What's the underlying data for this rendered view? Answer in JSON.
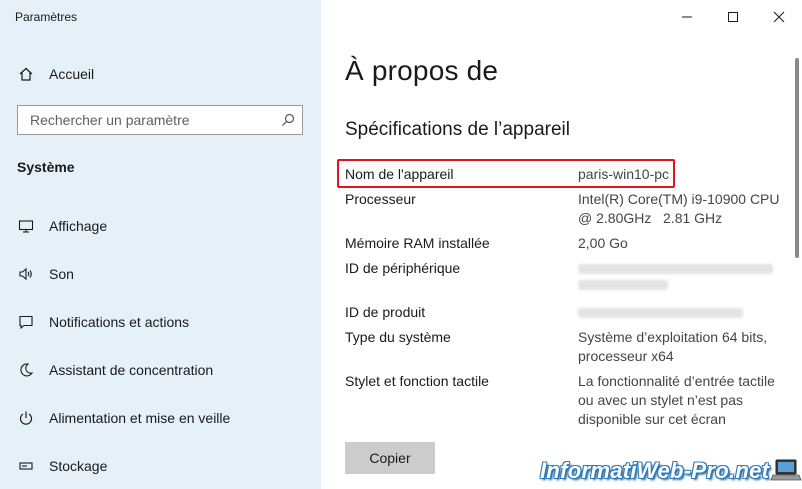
{
  "window": {
    "title": "Paramètres"
  },
  "sidebar": {
    "home_label": "Accueil",
    "search_placeholder": "Rechercher un paramètre",
    "section_title": "Système",
    "items": [
      {
        "label": "Affichage",
        "icon": "monitor-icon"
      },
      {
        "label": "Son",
        "icon": "speaker-icon"
      },
      {
        "label": "Notifications et actions",
        "icon": "notification-icon"
      },
      {
        "label": "Assistant de concentration",
        "icon": "moon-icon"
      },
      {
        "label": "Alimentation et mise en veille",
        "icon": "power-icon"
      },
      {
        "label": "Stockage",
        "icon": "storage-icon"
      }
    ]
  },
  "main": {
    "title": "À propos de",
    "section_title": "Spécifications de l’appareil",
    "specs": [
      {
        "label": "Nom de l'appareil",
        "value": "paris-win10-pc"
      },
      {
        "label": "Processeur",
        "value_line1": "Intel(R) Core(TM) i9-10900 CPU",
        "value_line2": "@ 2.80GHz   2.81 GHz"
      },
      {
        "label": "Mémoire RAM installée",
        "value": "2,00 Go"
      },
      {
        "label": "ID de périphérique",
        "value": ""
      },
      {
        "label": "ID de produit",
        "value": ""
      },
      {
        "label": "Type du système",
        "value_line1": "Système d’exploitation 64 bits,",
        "value_line2": "processeur x64"
      },
      {
        "label": "Stylet et fonction tactile",
        "value_line1": "La fonctionnalité d’entrée tactile",
        "value_line2": "ou avec un stylet n’est pas",
        "value_line3": "disponible sur cet écran"
      }
    ],
    "copy_button": "Copier"
  },
  "watermark": {
    "text": "InformatiWeb-Pro.net"
  },
  "colors": {
    "sidebar_bg": "#e6f0f8",
    "highlight": "#e0141e",
    "button_bg": "#cccccc"
  }
}
